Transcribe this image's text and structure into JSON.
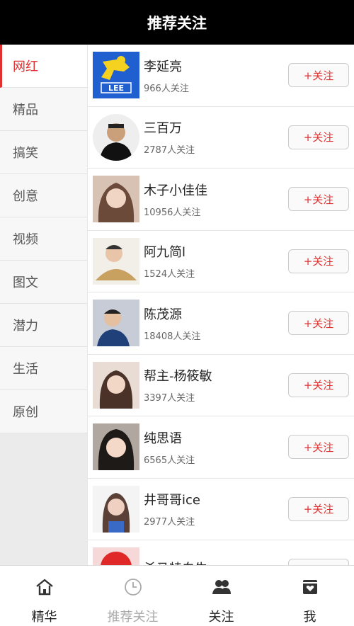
{
  "header": {
    "title": "推荐关注"
  },
  "sidebar": {
    "items": [
      {
        "label": "网红"
      },
      {
        "label": "精品"
      },
      {
        "label": "搞笑"
      },
      {
        "label": "创意"
      },
      {
        "label": "视频"
      },
      {
        "label": "图文"
      },
      {
        "label": "潜力"
      },
      {
        "label": "生活"
      },
      {
        "label": "原创"
      }
    ]
  },
  "list": {
    "follow_label": "+关注",
    "rows": [
      {
        "name": "李延亮",
        "fans": "966人关注",
        "avatar": "lee-logo"
      },
      {
        "name": "三百万",
        "fans": "2787人关注",
        "avatar": "round-portrait"
      },
      {
        "name": "木子小佳佳",
        "fans": "10956人关注",
        "avatar": "portrait"
      },
      {
        "name": "阿九简l",
        "fans": "1524人关注",
        "avatar": "portrait"
      },
      {
        "name": "陈茂源",
        "fans": "18408人关注",
        "avatar": "portrait"
      },
      {
        "name": "帮主-杨筱敏",
        "fans": "3397人关注",
        "avatar": "portrait"
      },
      {
        "name": "纯思语",
        "fans": "6565人关注",
        "avatar": "portrait"
      },
      {
        "name": "井哥哥ice",
        "fans": "2977人关注",
        "avatar": "portrait"
      },
      {
        "name": "杀马特白牛",
        "fans": "",
        "avatar": "portrait"
      }
    ]
  },
  "tabbar": {
    "tabs": [
      {
        "label": "精华",
        "icon": "home-icon"
      },
      {
        "label": "推荐关注",
        "icon": "clock-icon"
      },
      {
        "label": "关注",
        "icon": "users-icon"
      },
      {
        "label": "我",
        "icon": "profile-box-icon"
      }
    ]
  },
  "colors": {
    "accent": "#e03030",
    "header_bg": "#000000",
    "inactive_tab": "#aaaaaa"
  }
}
